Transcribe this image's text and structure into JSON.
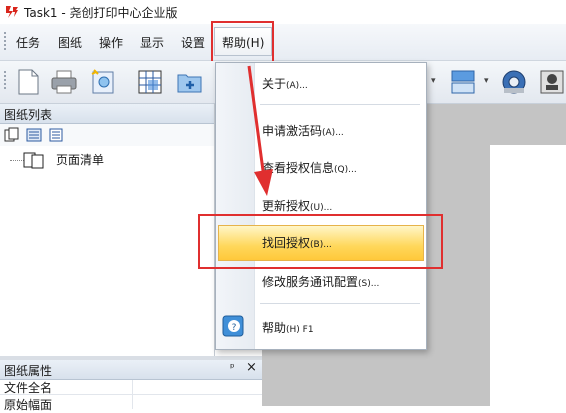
{
  "window": {
    "title": "Task1 - 尧创打印中心企业版"
  },
  "menubar": {
    "items": [
      "任务",
      "图纸",
      "操作",
      "显示",
      "设置"
    ],
    "help": "帮助(H)"
  },
  "left_panel": {
    "drawing_list_title": "图纸列表",
    "tree_item": "页面清单",
    "properties_title": "图纸属性",
    "pin_glyph": "ᵖ",
    "close_glyph": "×",
    "properties_rows": [
      "文件全名",
      "原始幅面"
    ]
  },
  "help_menu": {
    "about": {
      "label": "关于",
      "key": "(A)..."
    },
    "apply_code": {
      "label": "申请激活码",
      "key": "(A)..."
    },
    "view_license": {
      "label": "查看授权信息",
      "key": "(Q)..."
    },
    "update_license": {
      "label": "更新授权",
      "key": "(U)..."
    },
    "recover_license": {
      "label": "找回授权",
      "key": "(B)..."
    },
    "service_config": {
      "label": "修改服务通讯配置",
      "key": "(S)..."
    },
    "help": {
      "label": "帮助",
      "key": "(H) F1"
    }
  },
  "colors": {
    "highlight": "#e02f2f",
    "selected_item": "#ffd75a",
    "work_area": "#c4c4c4"
  }
}
